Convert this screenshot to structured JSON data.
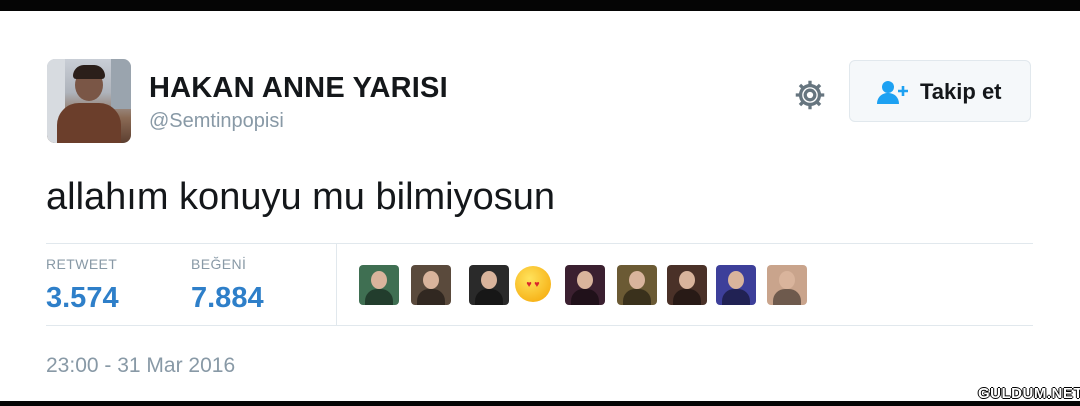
{
  "tweet": {
    "display_name": "HAKAN ANNE YARISI",
    "handle": "@Semtinpopisi",
    "text": "allahım konuyu mu bilmiyosun",
    "timestamp": "23:00 - 31 Mar 2016"
  },
  "header": {
    "follow_label": "Takip et",
    "settings_icon": "gear-icon",
    "follow_icon": "add-user-icon"
  },
  "stats": {
    "retweets_label": "RETWEET",
    "retweets_value": "3.574",
    "likes_label": "BEĞENİ",
    "likes_value": "7.884"
  },
  "likers": [
    {
      "icon": "liker-avatar",
      "color": "#3f6f52"
    },
    {
      "icon": "liker-avatar",
      "color": "#5a4a3c"
    },
    {
      "icon": "liker-avatar",
      "color": "#2a2a2a"
    },
    {
      "icon": "heart-eyes-emoji",
      "color": "#f7b319"
    },
    {
      "icon": "liker-avatar",
      "color": "#3b2030"
    },
    {
      "icon": "liker-avatar",
      "color": "#6b5a34"
    },
    {
      "icon": "liker-avatar",
      "color": "#4a3128"
    },
    {
      "icon": "liker-avatar",
      "color": "#3d3f9a"
    },
    {
      "icon": "liker-avatar",
      "color": "#c9a48c"
    }
  ],
  "watermark": "GULDUM.NET",
  "colors": {
    "accent_blue": "#2e7fc9",
    "muted": "#8899a6",
    "text": "#14171a"
  }
}
